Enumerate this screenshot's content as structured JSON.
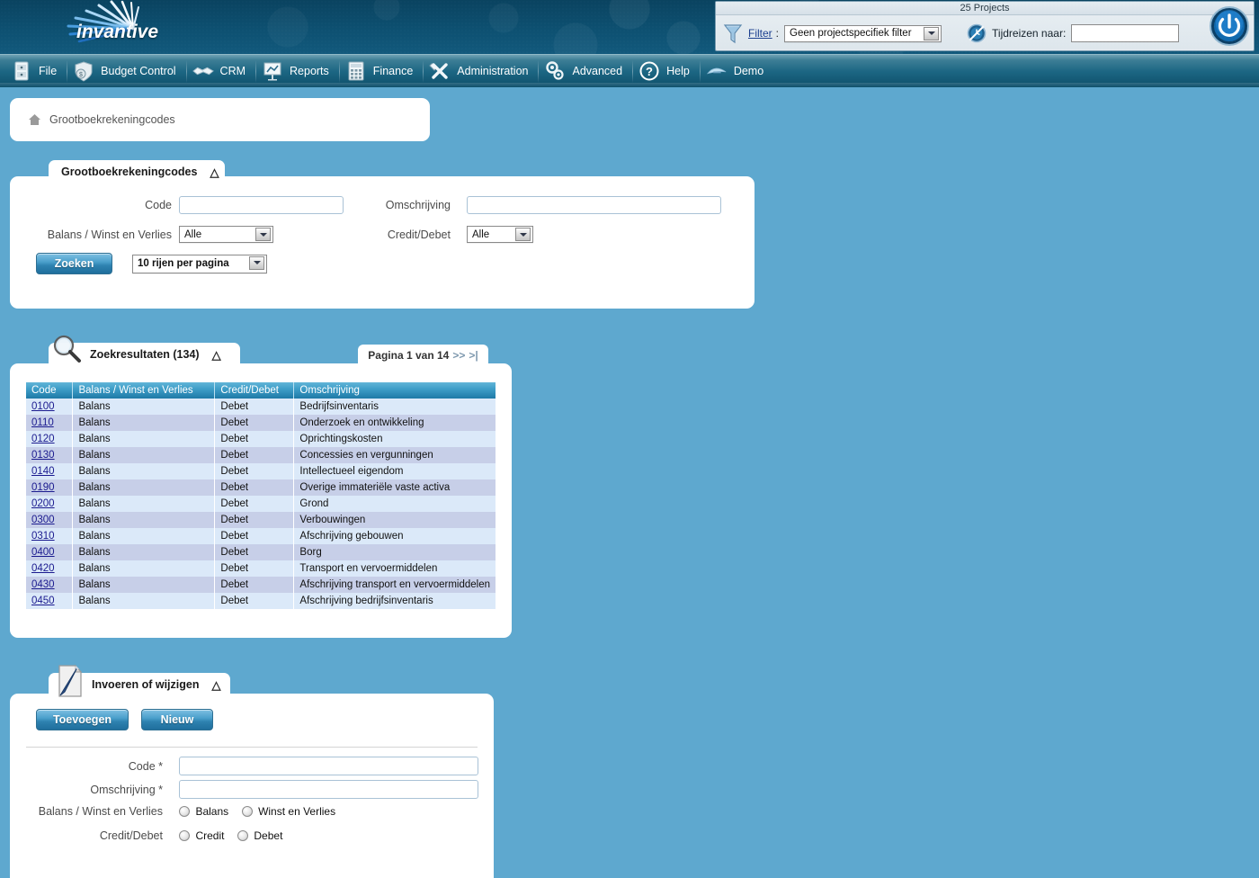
{
  "header": {
    "logo_text": "invantive",
    "logo_icon": "rays-burst-icon"
  },
  "project_bar": {
    "title": "25 Projects",
    "filter_icon": "funnel-icon",
    "filter_label": "Filter",
    "filter_colon": ":",
    "filter_value": "Geen projectspecifiek filter",
    "clock_icon": "time-travel-clock-icon",
    "timetravel_label": "Tijdreizen naar:",
    "timetravel_value": "",
    "power_icon": "power-icon"
  },
  "menu": {
    "items": [
      {
        "label": "File",
        "icon": "file-cabinet-icon"
      },
      {
        "label": "Budget Control",
        "icon": "shield-coin-icon"
      },
      {
        "label": "CRM",
        "icon": "handshake-icon"
      },
      {
        "label": "Reports",
        "icon": "presentation-chart-icon"
      },
      {
        "label": "Finance",
        "icon": "calculator-icon"
      },
      {
        "label": "Administration",
        "icon": "wrench-screwdriver-icon"
      },
      {
        "label": "Advanced",
        "icon": "gears-icon"
      },
      {
        "label": "Help",
        "icon": "question-mark-icon"
      },
      {
        "label": "Demo",
        "icon": "bird-icon"
      }
    ]
  },
  "breadcrumb": {
    "home_icon": "home-icon",
    "label": "Grootboekrekeningcodes"
  },
  "search_panel": {
    "tab_title": "Grootboekrekeningcodes",
    "collapse_icon": "chevron-up-icon",
    "code_label": "Code",
    "code_value": "",
    "omschrijving_label": "Omschrijving",
    "omschrijving_value": "",
    "bwv_label": "Balans / Winst en Verlies",
    "bwv_value": "Alle",
    "creditdebet_label": "Credit/Debet",
    "creditdebet_value": "Alle",
    "search_button": "Zoeken",
    "rows_per_page": "10 rijen per pagina"
  },
  "results_panel": {
    "search_icon": "magnifier-icon",
    "tab_title": "Zoekresultaten (134)",
    "collapse_icon": "chevron-up-icon",
    "pager_text": "Pagina 1 van 14",
    "pager_next": ">>",
    "pager_last": ">|",
    "columns": [
      "Code",
      "Balans / Winst en Verlies",
      "Credit/Debet",
      "Omschrijving"
    ],
    "rows": [
      {
        "code": "0100",
        "bwv": "Balans",
        "cd": "Debet",
        "omschrijving": "Bedrijfsinventaris"
      },
      {
        "code": "0110",
        "bwv": "Balans",
        "cd": "Debet",
        "omschrijving": "Onderzoek en ontwikkeling"
      },
      {
        "code": "0120",
        "bwv": "Balans",
        "cd": "Debet",
        "omschrijving": "Oprichtingskosten"
      },
      {
        "code": "0130",
        "bwv": "Balans",
        "cd": "Debet",
        "omschrijving": "Concessies en vergunningen"
      },
      {
        "code": "0140",
        "bwv": "Balans",
        "cd": "Debet",
        "omschrijving": "Intellectueel eigendom"
      },
      {
        "code": "0190",
        "bwv": "Balans",
        "cd": "Debet",
        "omschrijving": "Overige immateriële vaste activa"
      },
      {
        "code": "0200",
        "bwv": "Balans",
        "cd": "Debet",
        "omschrijving": "Grond"
      },
      {
        "code": "0300",
        "bwv": "Balans",
        "cd": "Debet",
        "omschrijving": "Verbouwingen"
      },
      {
        "code": "0310",
        "bwv": "Balans",
        "cd": "Debet",
        "omschrijving": "Afschrijving gebouwen"
      },
      {
        "code": "0400",
        "bwv": "Balans",
        "cd": "Debet",
        "omschrijving": "Borg"
      },
      {
        "code": "0420",
        "bwv": "Balans",
        "cd": "Debet",
        "omschrijving": "Transport en vervoermiddelen"
      },
      {
        "code": "0430",
        "bwv": "Balans",
        "cd": "Debet",
        "omschrijving": "Afschrijving transport en vervoermiddelen"
      },
      {
        "code": "0450",
        "bwv": "Balans",
        "cd": "Debet",
        "omschrijving": "Afschrijving bedrijfsinventaris"
      }
    ]
  },
  "edit_panel": {
    "note_icon": "note-pencil-icon",
    "tab_title": "Invoeren of wijzigen",
    "collapse_icon": "chevron-up-icon",
    "add_button": "Toevoegen",
    "new_button": "Nieuw",
    "code_label": "Code *",
    "code_value": "",
    "omschrijving_label": "Omschrijving *",
    "omschrijving_value": "",
    "bwv_label": "Balans / Winst en Verlies",
    "bwv_option1": "Balans",
    "bwv_option2": "Winst en Verlies",
    "creditdebet_label": "Credit/Debet",
    "cd_option1": "Credit",
    "cd_option2": "Debet"
  },
  "colors": {
    "page_background": "#5ea8cf",
    "header_dark": "#0d5071",
    "accent_blue": "#2e8cb8",
    "row_odd": "#dbe9f9",
    "row_even": "#c7cfe8",
    "link": "#1b1b8f"
  }
}
